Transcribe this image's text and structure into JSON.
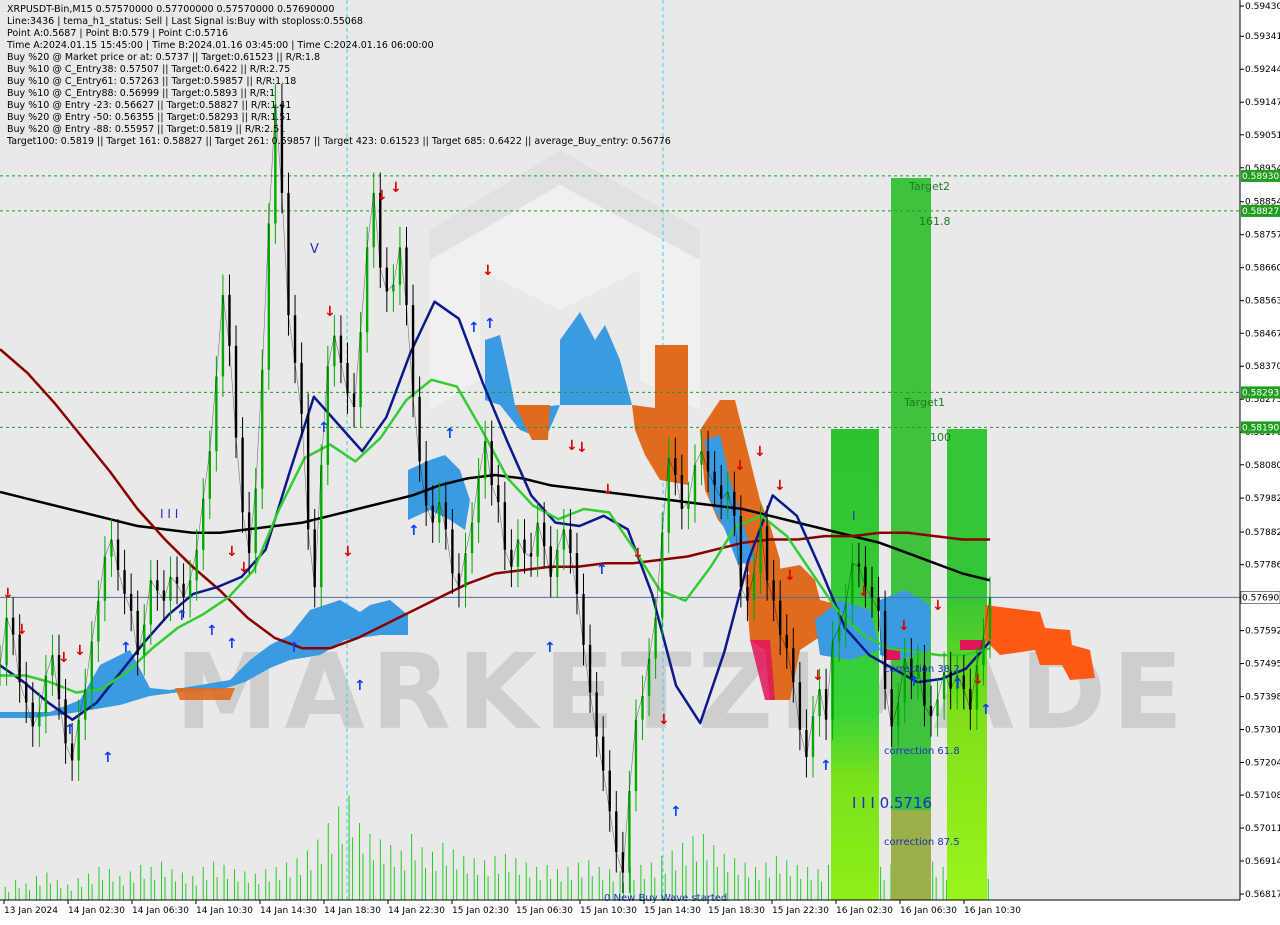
{
  "header": {
    "lines": [
      "XRPUSDT-Bin,M15  0.57570000 0.57700000 0.57570000 0.57690000",
      "Line:3436 | tema_h1_status: Sell | Last Signal is:Buy with stoploss:0.55068",
      "Point A:0.5687 | Point B:0.579 | Point C:0.5716",
      "Time A:2024.01.15 15:45:00 | Time B:2024.01.16 03:45:00 | Time C:2024.01.16 06:00:00",
      "Buy %20 @ Market price or at: 0.5737 || Target:0.61523 || R/R:1.8",
      "Buy %10 @ C_Entry38: 0.57507 || Target:0.6422 || R/R:2.75",
      "Buy %10 @ C_Entry61: 0.57263 || Target:0.59857 || R/R:1.18",
      "Buy %10 @ C_Entry88: 0.56999 || Target:0.5893 || R/R:1",
      "Buy %10 @ Entry -23: 0.56627 || Target:0.58827 || R/R:1.41",
      "Buy %20 @ Entry -50: 0.56355 || Target:0.58293 || R/R:1.51",
      "Buy %20 @ Entry -88: 0.55957 || Target:0.5819 || R/R:2.51",
      "Target100: 0.5819 || Target 161: 0.58827 || Target 261: 0.59857 || Target 423: 0.61523 || Target 685: 0.6422 || average_Buy_entry: 0.56776"
    ]
  },
  "watermark": "MARKETZIMADE",
  "colors": {
    "bull_candle": "#00aa00",
    "bear_candle": "#000000",
    "price_line": "#4a6fa5",
    "level_green": "#1f9d1f",
    "zone_green": "#2ecc2e",
    "zone_lime": "#7fff00",
    "cloud_blue": "#3a9be0",
    "cloud_orange": "#e06a1e",
    "ma_black": "#000000",
    "ma_darkred": "#8b0000",
    "ma_navy": "#0a1a8a",
    "ma_green": "#33cc33",
    "volume": "#22cc22",
    "arrow_up": "#0a3cff",
    "arrow_down": "#e00000"
  },
  "annotations": {
    "target2": "Target2",
    "fib_161": "161.8",
    "target1": "Target1",
    "fib_100": "100",
    "correction_38": "correction 38.2",
    "correction_61": "correction 61.8",
    "correction_87": "correction 87.5",
    "wave_c": "I I I 0.5716",
    "wave_status": "0 New Buy Wave started",
    "wave_mark_1": "I I I",
    "wave_mark_2": "V",
    "wave_mark_3": "I"
  },
  "chart_data": {
    "type": "candlestick",
    "symbol": "XRPUSDT-Bin",
    "timeframe": "M15",
    "ylim": [
      0.56817,
      0.5943
    ],
    "y_ticks": [
      "0.59430",
      "0.59341",
      "0.59244",
      "0.59147",
      "0.59051",
      "0.58954",
      "0.58854",
      "0.58757",
      "0.58660",
      "0.58563",
      "0.58467",
      "0.58370",
      "0.58273",
      "0.58176",
      "0.58080",
      "0.57982",
      "0.57882",
      "0.57786",
      "0.57690",
      "0.57592",
      "0.57495",
      "0.57398",
      "0.57301",
      "0.57204",
      "0.57108",
      "0.57011",
      "0.56914",
      "0.56817"
    ],
    "x_ticks": [
      "13 Jan 2024",
      "14 Jan 02:30",
      "14 Jan 06:30",
      "14 Jan 10:30",
      "14 Jan 14:30",
      "14 Jan 18:30",
      "14 Jan 22:30",
      "15 Jan 02:30",
      "15 Jan 06:30",
      "15 Jan 10:30",
      "15 Jan 14:30",
      "15 Jan 18:30",
      "15 Jan 22:30",
      "16 Jan 02:30",
      "16 Jan 06:30",
      "16 Jan 10:30"
    ],
    "current_price": {
      "value": 0.5769,
      "label": "0.57690"
    },
    "levels": [
      {
        "name": "Target 261",
        "value": 0.5893,
        "label": "0.58930"
      },
      {
        "name": "Target 161",
        "value": 0.58827,
        "label": "0.58827"
      },
      {
        "name": "Target 100 upper",
        "value": 0.58293,
        "label": "0.58293"
      },
      {
        "name": "Target 100",
        "value": 0.5819,
        "label": "0.58190"
      }
    ],
    "price_series": [
      0.5749,
      0.5763,
      0.5758,
      0.5744,
      0.5738,
      0.5731,
      0.5735,
      0.5746,
      0.5752,
      0.5739,
      0.5726,
      0.5721,
      0.5733,
      0.5742,
      0.5756,
      0.5768,
      0.5781,
      0.5786,
      0.5777,
      0.577,
      0.5765,
      0.5752,
      0.5761,
      0.5774,
      0.5771,
      0.5768,
      0.5775,
      0.5773,
      0.5769,
      0.5774,
      0.5783,
      0.5798,
      0.5812,
      0.5834,
      0.5858,
      0.5843,
      0.5816,
      0.5794,
      0.5782,
      0.5801,
      0.5836,
      0.5879,
      0.5914,
      0.5888,
      0.5852,
      0.5838,
      0.5823,
      0.5789,
      0.5772,
      0.5808,
      0.5837,
      0.5846,
      0.5838,
      0.5829,
      0.5825,
      0.5847,
      0.5872,
      0.5888,
      0.5866,
      0.5859,
      0.5861,
      0.5872,
      0.5855,
      0.5828,
      0.5809,
      0.5796,
      0.5791,
      0.5797,
      0.5789,
      0.5776,
      0.5772,
      0.5782,
      0.5791,
      0.5804,
      0.5815,
      0.5802,
      0.5797,
      0.5783,
      0.5778,
      0.5786,
      0.5782,
      0.5781,
      0.5791,
      0.5784,
      0.5775,
      0.5783,
      0.5789,
      0.5782,
      0.577,
      0.5755,
      0.5741,
      0.5728,
      0.5718,
      0.5706,
      0.5694,
      0.5688,
      0.5712,
      0.5733,
      0.574,
      0.5751,
      0.5763,
      0.5788,
      0.581,
      0.5805,
      0.5795,
      0.5797,
      0.5808,
      0.5812,
      0.5806,
      0.5802,
      0.5798,
      0.58,
      0.5793,
      0.5772,
      0.5768,
      0.5776,
      0.579,
      0.5774,
      0.5768,
      0.5758,
      0.5754,
      0.5744,
      0.573,
      0.5722,
      0.5734,
      0.5742,
      0.5733,
      0.5756,
      0.576,
      0.5767,
      0.5779,
      0.5778,
      0.5772,
      0.5769,
      0.5765,
      0.5742,
      0.5731,
      0.5738,
      0.5751,
      0.5745,
      0.5749,
      0.5737,
      0.5734,
      0.5739,
      0.5747,
      0.5742,
      0.5746,
      0.5742,
      0.5736,
      0.5749,
      0.5757,
      0.5769
    ],
    "series": [
      {
        "name": "black",
        "values": [
          0.58,
          0.5798,
          0.5796,
          0.5794,
          0.5792,
          0.579,
          0.5789,
          0.5788,
          0.5788,
          0.5789,
          0.579,
          0.5791,
          0.5793,
          0.5795,
          0.5797,
          0.5799,
          0.5802,
          0.5804,
          0.5805,
          0.5804,
          0.5802,
          0.5801,
          0.58,
          0.5799,
          0.5798,
          0.5797,
          0.5796,
          0.5795,
          0.5793,
          0.5791,
          0.5789,
          0.5787,
          0.5785,
          0.5782,
          0.5779,
          0.5776,
          0.5774
        ]
      },
      {
        "name": "darkred",
        "values": [
          0.5842,
          0.5835,
          0.5826,
          0.5816,
          0.5806,
          0.5795,
          0.5786,
          0.5778,
          0.5771,
          0.5763,
          0.5757,
          0.5754,
          0.5754,
          0.5757,
          0.5761,
          0.5765,
          0.5769,
          0.5773,
          0.5776,
          0.5777,
          0.5778,
          0.5778,
          0.5779,
          0.5779,
          0.578,
          0.5781,
          0.5783,
          0.5785,
          0.5786,
          0.5786,
          0.5787,
          0.5787,
          0.5788,
          0.5788,
          0.5787,
          0.5786,
          0.5786
        ]
      },
      {
        "name": "navy",
        "values": [
          0.5749,
          0.5744,
          0.5738,
          0.5733,
          0.5738,
          0.5747,
          0.5756,
          0.5764,
          0.577,
          0.5772,
          0.5775,
          0.5783,
          0.5806,
          0.5828,
          0.582,
          0.5812,
          0.5822,
          0.5841,
          0.5856,
          0.5851,
          0.5832,
          0.5815,
          0.5799,
          0.5791,
          0.579,
          0.5793,
          0.5789,
          0.577,
          0.5743,
          0.5732,
          0.5753,
          0.578,
          0.5799,
          0.5793,
          0.5777,
          0.576,
          0.5752,
          0.5748,
          0.5744,
          0.5745,
          0.5748,
          0.5756
        ]
      },
      {
        "name": "green",
        "values": [
          0.5746,
          0.5746,
          0.5744,
          0.5741,
          0.5742,
          0.5747,
          0.5754,
          0.576,
          0.5764,
          0.5769,
          0.5777,
          0.5795,
          0.581,
          0.5814,
          0.5809,
          0.5816,
          0.5827,
          0.5833,
          0.5831,
          0.5818,
          0.5804,
          0.5796,
          0.5792,
          0.5795,
          0.5794,
          0.5783,
          0.5771,
          0.5768,
          0.5778,
          0.579,
          0.5793,
          0.5787,
          0.5776,
          0.5765,
          0.5758,
          0.5754,
          0.5753,
          0.5752,
          0.5752,
          0.5754
        ]
      }
    ],
    "volume_ylim": [
      0,
      100
    ],
    "volume": [
      12,
      18,
      15,
      22,
      25,
      18,
      14,
      20,
      24,
      30,
      28,
      22,
      26,
      32,
      30,
      35,
      28,
      25,
      22,
      30,
      35,
      32,
      28,
      26,
      24,
      28,
      30,
      34,
      38,
      45,
      55,
      70,
      85,
      95,
      70,
      60,
      55,
      50,
      45,
      60,
      48,
      44,
      52,
      46,
      40,
      38,
      36,
      40,
      42,
      38,
      34,
      30,
      32,
      28,
      30,
      34,
      36,
      30,
      28,
      26,
      30,
      32,
      34,
      40,
      45,
      52,
      58,
      60,
      50,
      42,
      38,
      34,
      30,
      34,
      40,
      36,
      32,
      30,
      28,
      32,
      35,
      30,
      28,
      26,
      30,
      32,
      34,
      36,
      38,
      35,
      30,
      28,
      26,
      30,
      32
    ]
  }
}
